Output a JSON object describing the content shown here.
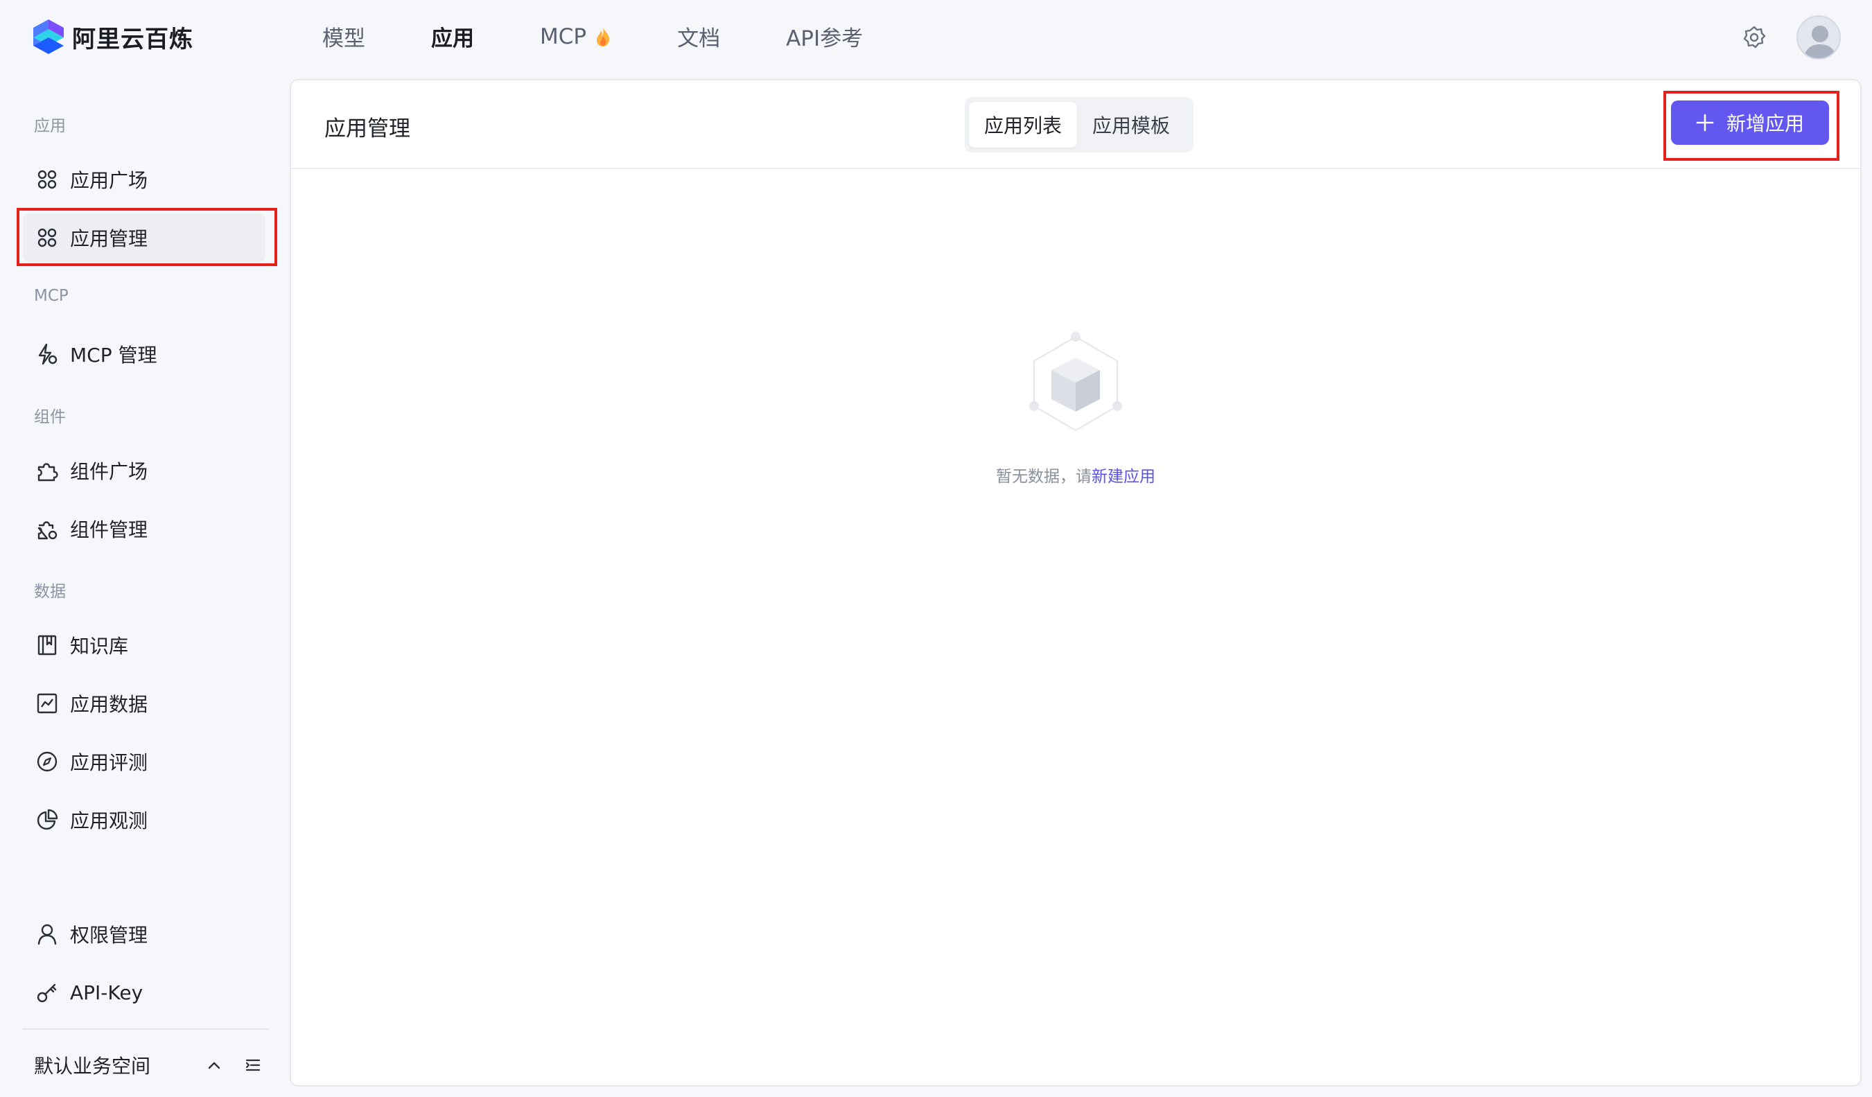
{
  "brand": {
    "name": "阿里云百炼"
  },
  "topnav": [
    {
      "label": "模型"
    },
    {
      "label": "应用"
    },
    {
      "label": "MCP"
    },
    {
      "label": "文档"
    },
    {
      "label": "API参考"
    }
  ],
  "sidebar": {
    "sections": {
      "app": "应用",
      "mcp": "MCP",
      "component": "组件",
      "data": "数据"
    },
    "items": {
      "app_plaza": "应用广场",
      "app_manage": "应用管理",
      "mcp_manage": "MCP 管理",
      "comp_plaza": "组件广场",
      "comp_manage": "组件管理",
      "knowledge": "知识库",
      "app_data": "应用数据",
      "app_eval": "应用评测",
      "app_observe": "应用观测",
      "permission": "权限管理",
      "api_key": "API-Key"
    },
    "workspace": "默认业务空间"
  },
  "main": {
    "title": "应用管理",
    "tabs": [
      "应用列表",
      "应用模板"
    ],
    "add_button": "新增应用",
    "empty_prefix": "暂无数据，请",
    "empty_link": "新建应用"
  },
  "colors": {
    "accent": "#6257ee",
    "highlight": "#e5211b"
  }
}
